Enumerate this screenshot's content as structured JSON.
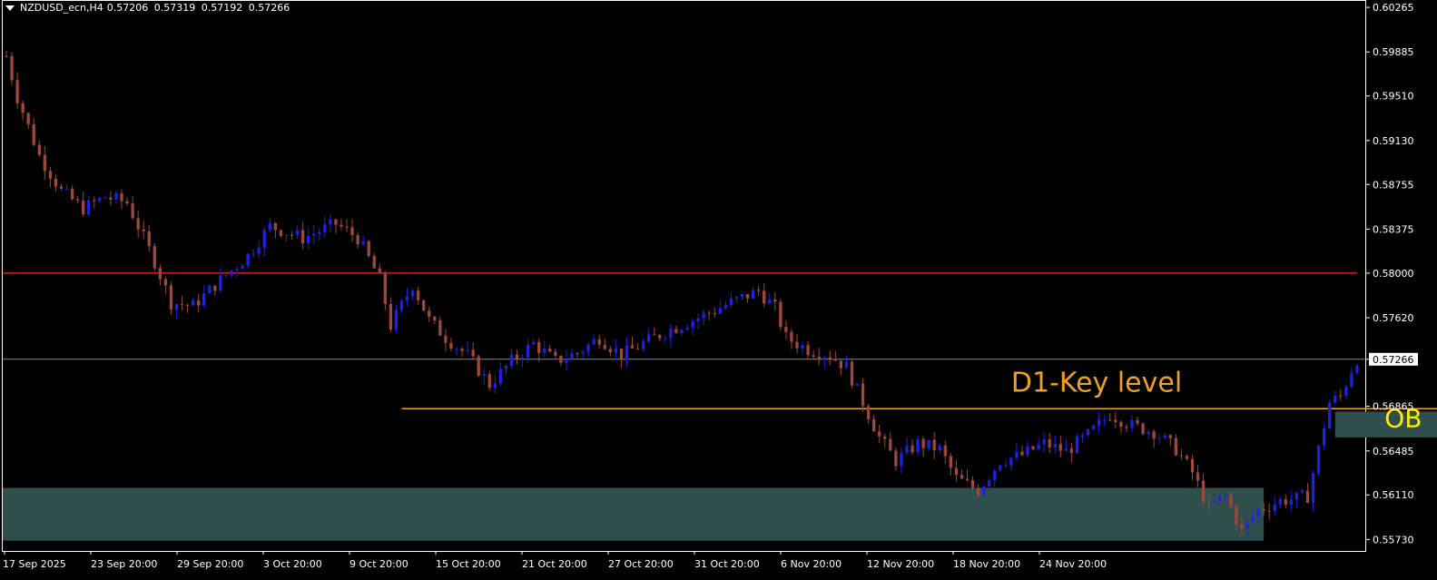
{
  "header": {
    "symbol_tf": "NZDUSD_ecn,H4",
    "open": "0.57206",
    "high": "0.57319",
    "low": "0.57192",
    "close": "0.57266"
  },
  "colors": {
    "background": "#000000",
    "frame": "#ffffff",
    "bull_candle": "#1e22e0",
    "bear_candle": "#a0473c",
    "resistance_line": "#e01b1b",
    "key_level": "#f0a020",
    "zone_fill": "#2f4e4c",
    "check_mark": "#ffee00",
    "current_price_line": "#8a8a8a"
  },
  "icons": {
    "check": "check-mark-icon",
    "collapse": "triangle-down-icon"
  },
  "chart_data": {
    "type": "candlestick",
    "symbol": "NZDUSD_ecn",
    "timeframe": "H4",
    "ylim": [
      0.5564,
      0.6032
    ],
    "y_ticks": [
      "0.60265",
      "0.59885",
      "0.59510",
      "0.59130",
      "0.58755",
      "0.58375",
      "0.58000",
      "0.57620",
      "0.57266",
      "0.56865",
      "0.56485",
      "0.56110",
      "0.55730"
    ],
    "x_ticks": [
      "17 Sep 2025",
      "23 Sep 20:00",
      "29 Sep 20:00",
      "3 Oct 20:00",
      "9 Oct 20:00",
      "15 Oct 20:00",
      "21 Oct 20:00",
      "27 Oct 20:00",
      "31 Oct 20:00",
      "6 Nov 20:00",
      "12 Nov 20:00",
      "18 Nov 20:00",
      "24 Nov 20:00"
    ],
    "price_path": [
      [
        0,
        0.5985
      ],
      [
        2,
        0.595
      ],
      [
        6,
        0.59
      ],
      [
        10,
        0.587
      ],
      [
        14,
        0.5855
      ],
      [
        18,
        0.5865
      ],
      [
        22,
        0.586
      ],
      [
        24,
        0.584
      ],
      [
        27,
        0.581
      ],
      [
        30,
        0.5775
      ],
      [
        34,
        0.5772
      ],
      [
        38,
        0.579
      ],
      [
        44,
        0.5815
      ],
      [
        48,
        0.584
      ],
      [
        54,
        0.583
      ],
      [
        60,
        0.5842
      ],
      [
        64,
        0.583
      ],
      [
        68,
        0.5795
      ],
      [
        70,
        0.5755
      ],
      [
        74,
        0.579
      ],
      [
        77,
        0.576
      ],
      [
        80,
        0.5745
      ],
      [
        84,
        0.573
      ],
      [
        88,
        0.5705
      ],
      [
        92,
        0.5725
      ],
      [
        96,
        0.574
      ],
      [
        100,
        0.5725
      ],
      [
        104,
        0.5732
      ],
      [
        108,
        0.5745
      ],
      [
        112,
        0.573
      ],
      [
        116,
        0.574
      ],
      [
        120,
        0.575
      ],
      [
        126,
        0.5762
      ],
      [
        132,
        0.5775
      ],
      [
        137,
        0.5785
      ],
      [
        140,
        0.577
      ],
      [
        142,
        0.5745
      ],
      [
        146,
        0.5735
      ],
      [
        150,
        0.573
      ],
      [
        153,
        0.572
      ],
      [
        156,
        0.569
      ],
      [
        159,
        0.566
      ],
      [
        162,
        0.564
      ],
      [
        166,
        0.5655
      ],
      [
        170,
        0.565
      ],
      [
        173,
        0.5625
      ],
      [
        177,
        0.5615
      ],
      [
        181,
        0.564
      ],
      [
        185,
        0.5645
      ],
      [
        189,
        0.5655
      ],
      [
        193,
        0.5648
      ],
      [
        197,
        0.5662
      ],
      [
        201,
        0.568
      ],
      [
        205,
        0.567
      ],
      [
        209,
        0.5665
      ],
      [
        213,
        0.565
      ],
      [
        216,
        0.563
      ],
      [
        219,
        0.56
      ],
      [
        222,
        0.561
      ],
      [
        225,
        0.558
      ],
      [
        228,
        0.5598
      ],
      [
        232,
        0.5606
      ],
      [
        235,
        0.5608
      ],
      [
        237,
        0.561
      ],
      [
        239,
        0.565
      ],
      [
        241,
        0.569
      ],
      [
        243,
        0.5695
      ],
      [
        245,
        0.5718
      ],
      [
        246,
        0.5727
      ]
    ],
    "levels": [
      {
        "name": "resistance",
        "price": 0.58
      },
      {
        "name": "D1 key level",
        "price": 0.56845
      },
      {
        "name": "current price",
        "price": 0.57266
      }
    ],
    "zones": [
      {
        "name": "demand-zone",
        "x_from": 0,
        "x_to": 229,
        "price_top": 0.5617,
        "price_bottom": 0.5572
      },
      {
        "name": "order-block",
        "x_from": 242,
        "x_to": 275,
        "price_top": 0.5682,
        "price_bottom": 0.566
      }
    ],
    "annotations": [
      {
        "text": "D1-Key level",
        "x": 183,
        "price": 0.5699
      },
      {
        "text": "OB",
        "x": 251,
        "price": 0.5669
      },
      {
        "text": "✓",
        "x": 262,
        "price": 0.5812
      }
    ],
    "grid": false,
    "current_price_label": "0.57266"
  }
}
